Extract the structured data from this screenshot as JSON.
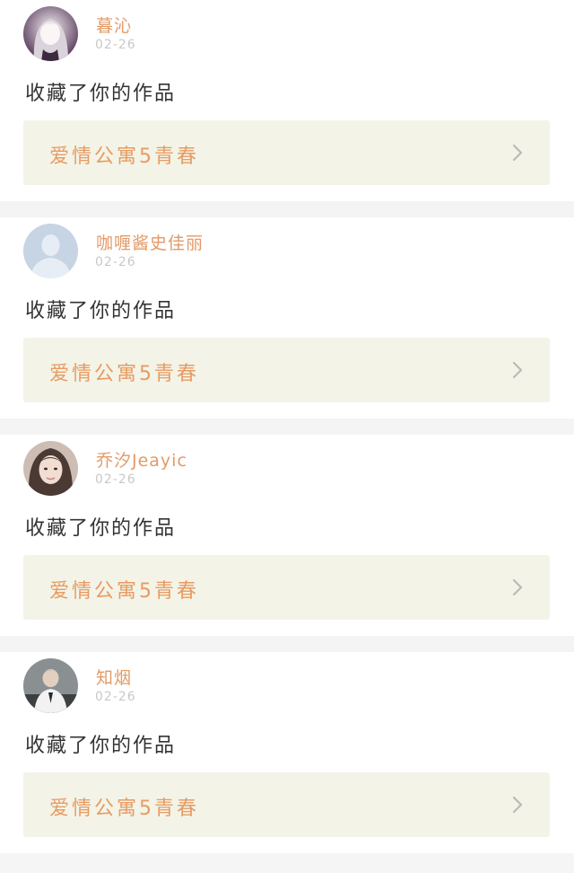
{
  "feed": {
    "items": [
      {
        "user_name": "暮沁",
        "time": "02-26",
        "action": "收藏了你的作品",
        "work_title": "爱情公寓5青春",
        "avatar_icon": "anime-girl-avatar"
      },
      {
        "user_name": "咖喱酱史佳丽",
        "time": "02-26",
        "action": "收藏了你的作品",
        "work_title": "爱情公寓5青春",
        "avatar_icon": "default-person-avatar"
      },
      {
        "user_name": "乔汐Jeayic",
        "time": "02-26",
        "action": "收藏了你的作品",
        "work_title": "爱情公寓5青春",
        "avatar_icon": "girl-photo-avatar"
      },
      {
        "user_name": "知烟",
        "time": "02-26",
        "action": "收藏了你的作品",
        "work_title": "爱情公寓5青春",
        "avatar_icon": "person-photo-avatar"
      }
    ]
  },
  "colors": {
    "accent": "#e39a68",
    "link_bg": "#f3f4e7",
    "divider": "#f4f4f4",
    "time": "#c9c9c9",
    "text": "#333333"
  }
}
